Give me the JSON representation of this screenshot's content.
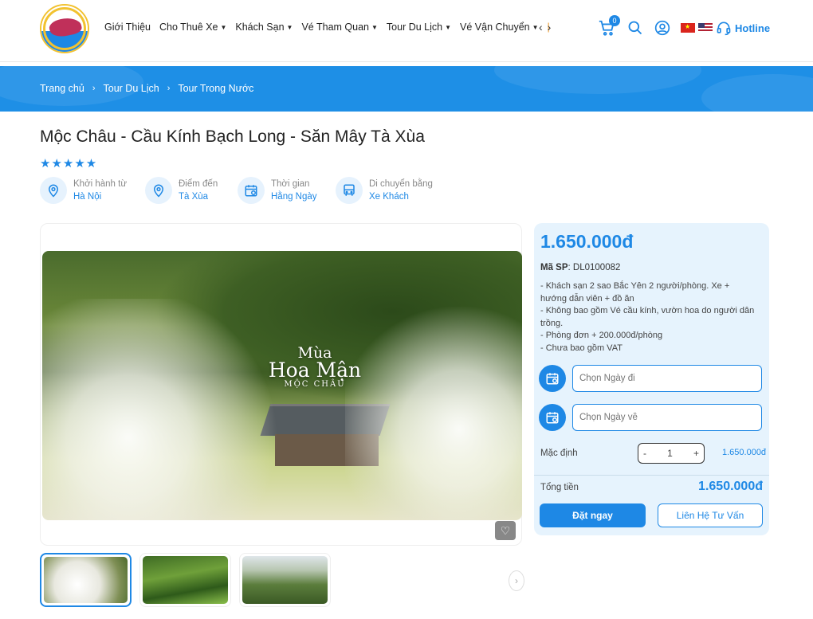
{
  "header": {
    "nav": [
      {
        "label": "Giới Thiệu",
        "has_caret": false
      },
      {
        "label": "Cho Thuê Xe",
        "has_caret": true
      },
      {
        "label": "Khách Sạn",
        "has_caret": true
      },
      {
        "label": "Vé Tham Quan",
        "has_caret": true
      },
      {
        "label": "Tour Du Lịch",
        "has_caret": true
      },
      {
        "label": "Vé Vận Chuyển",
        "has_caret": true
      }
    ],
    "cart_count": "0",
    "hotline_label": "Hotline",
    "colors": {
      "primary": "#1e88e5"
    }
  },
  "breadcrumb": [
    "Trang chủ",
    "Tour Du Lịch",
    "Tour Trong Nước"
  ],
  "product": {
    "title": "Mộc Châu - Cầu Kính Bạch Long - Săn Mây Tà Xùa",
    "rating": 5,
    "stars": "★★★★★",
    "meta": [
      {
        "label": "Khởi hành từ",
        "value": "Hà Nội",
        "icon": "map-pin-icon"
      },
      {
        "label": "Điểm đến",
        "value": "Tà Xùa",
        "icon": "map-pin-icon"
      },
      {
        "label": "Thời gian",
        "value": "Hằng Ngày",
        "icon": "calendar-icon"
      },
      {
        "label": "Di chuyển bằng",
        "value": "Xe Khách",
        "icon": "bus-icon"
      }
    ],
    "image_caption": {
      "line1": "Mùa",
      "line2": "Hoa Mận",
      "line3": "MỘC CHÂU"
    }
  },
  "booking": {
    "price": "1.650.000đ",
    "sku_label": "Mã SP",
    "sku": ": DL0100082",
    "description": [
      "- Khách sạn 2 sao Bắc Yên 2 người/phòng. Xe + hướng dẫn viên + đồ ăn",
      "- Không bao gồm Vé cầu kính, vườn hoa do người dân trồng.",
      "- Phòng đơn + 200.000đ/phòng",
      "- Chưa bao gồm VAT"
    ],
    "depart_placeholder": "Chọn Ngày đi",
    "return_placeholder": "Chọn Ngày về",
    "qty_label": "Mặc định",
    "qty_minus": "-",
    "qty_plus": "+",
    "qty_value": "1",
    "unit_price": "1.650.000đ",
    "total_label": "Tổng tiền",
    "total_value": "1.650.000đ",
    "book_label": "Đặt ngay",
    "contact_label": "Liên Hệ Tư Vấn"
  }
}
